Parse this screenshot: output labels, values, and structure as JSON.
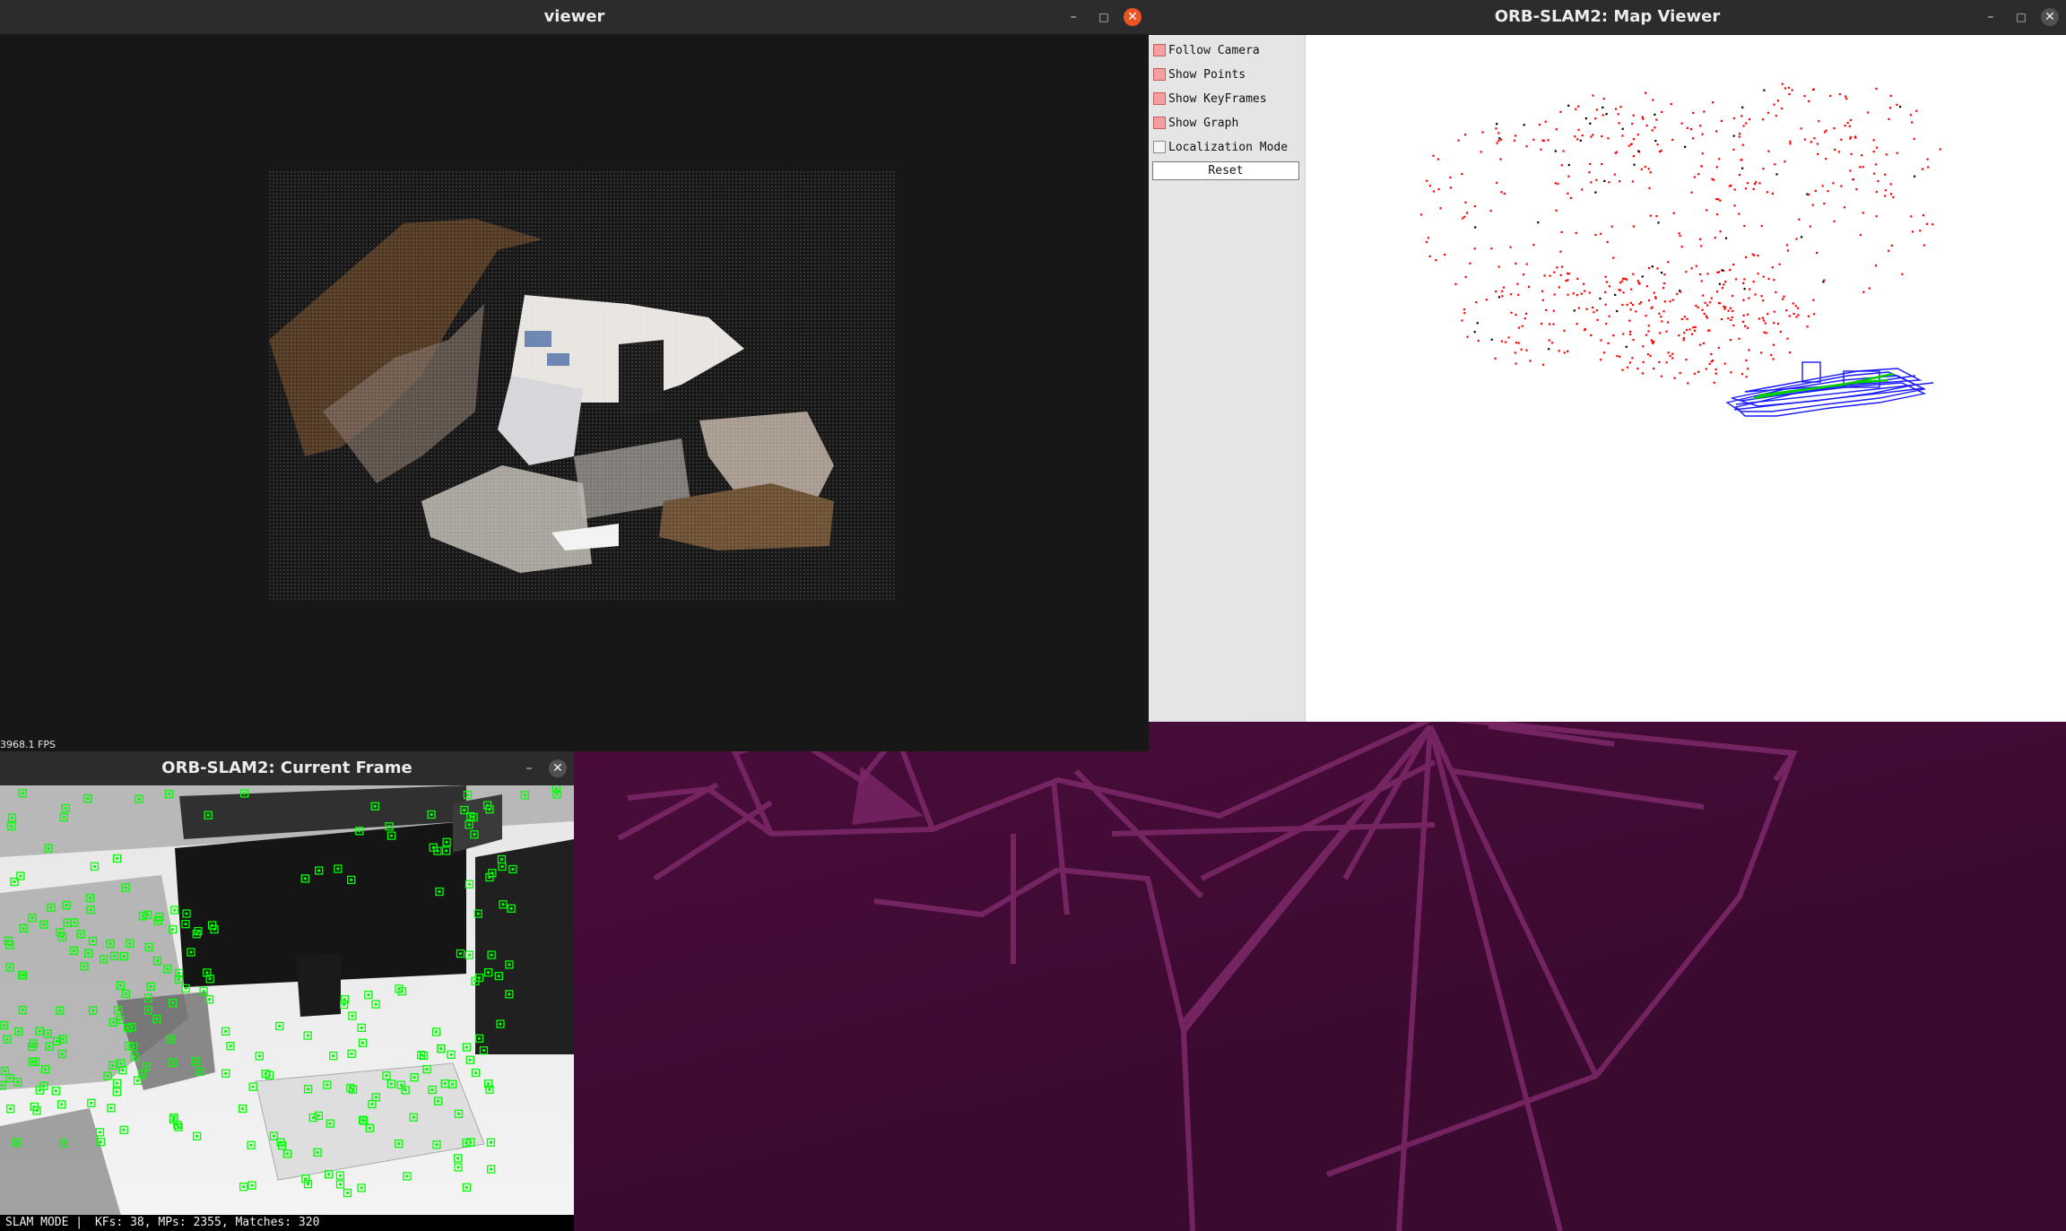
{
  "desktop": {
    "background": "#3a0d2e",
    "accent": "#e95420"
  },
  "viewer_window": {
    "title": "viewer",
    "fps": "3968.1 FPS",
    "close_color": "#e95420"
  },
  "map_window": {
    "title": "ORB-SLAM2: Map Viewer",
    "panel": {
      "items": [
        {
          "label": "Follow Camera",
          "checked": true
        },
        {
          "label": "Show Points",
          "checked": true
        },
        {
          "label": "Show KeyFrames",
          "checked": true
        },
        {
          "label": "Show Graph",
          "checked": true
        },
        {
          "label": "Localization Mode",
          "checked": false
        }
      ],
      "reset_label": "Reset"
    },
    "colors": {
      "points": "#ff0000",
      "keyframes": "#0000ff",
      "graph": "#00cc00",
      "reference_points": "#000000"
    }
  },
  "frame_window": {
    "title": "ORB-SLAM2: Current Frame",
    "mode": "SLAM MODE",
    "stats": "KFs: 38, MPs: 2355, Matches: 320",
    "feature_color": "#00ff00"
  },
  "icons": {
    "minimize": "minimize-icon",
    "maximize": "maximize-icon",
    "close": "close-icon"
  }
}
